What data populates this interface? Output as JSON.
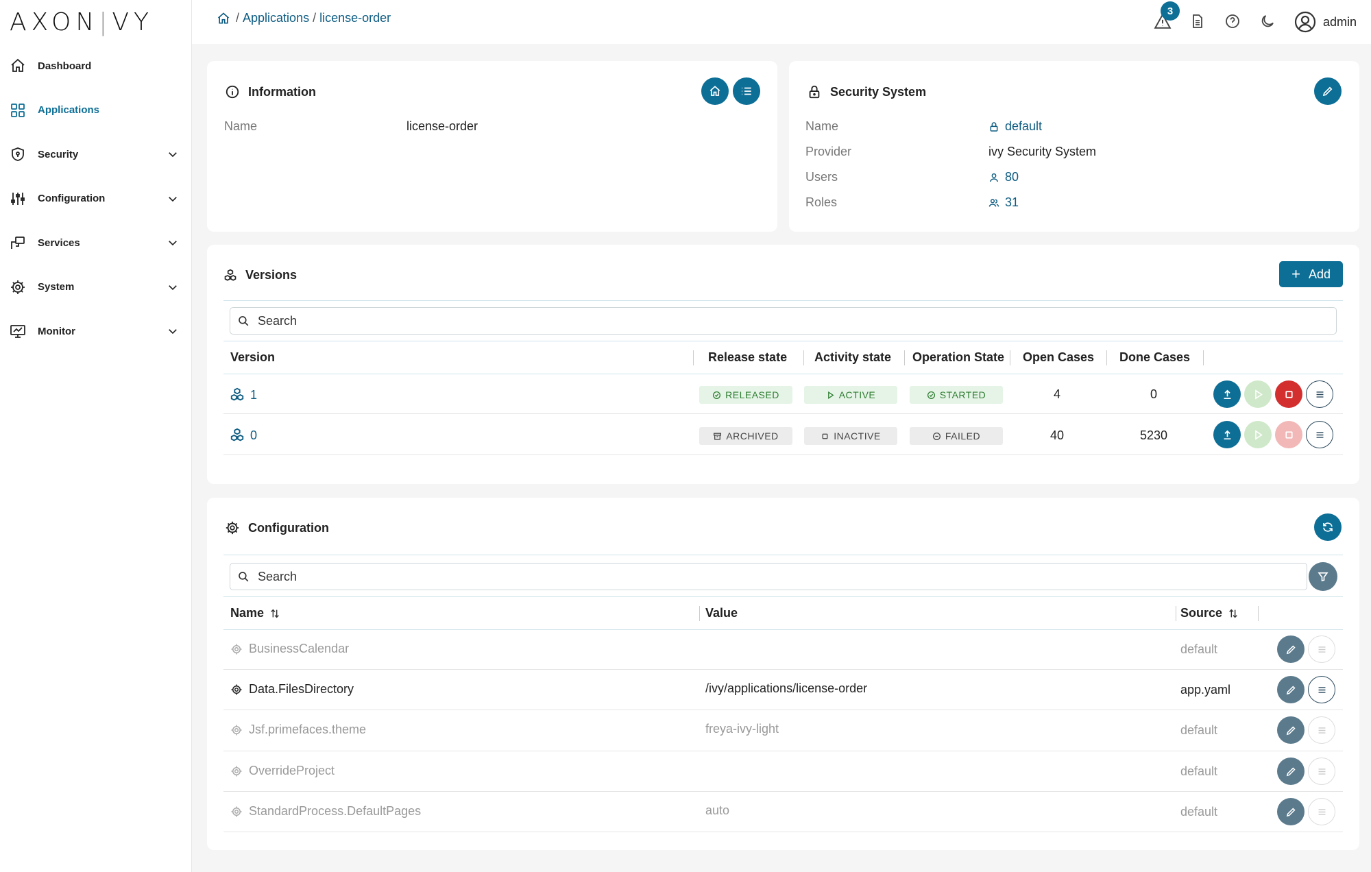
{
  "logo": {
    "left": "AXON",
    "sep": "|",
    "right": "VY"
  },
  "sidebar": {
    "items": [
      {
        "label": "Dashboard",
        "icon": "home-icon"
      },
      {
        "label": "Applications",
        "icon": "grid-icon",
        "active": true
      },
      {
        "label": "Security",
        "icon": "shield-icon"
      },
      {
        "label": "Configuration",
        "icon": "sliders-icon"
      },
      {
        "label": "Services",
        "icon": "services-icon"
      },
      {
        "label": "System",
        "icon": "gear-icon"
      },
      {
        "label": "Monitor",
        "icon": "monitor-icon"
      }
    ]
  },
  "topbar": {
    "breadcrumb": {
      "sep1": "/",
      "applications": "Applications",
      "sep2": "/",
      "current": "license-order"
    },
    "notifications_count": "3",
    "user": "admin"
  },
  "information": {
    "title": "Information",
    "name_label": "Name",
    "name_value": "license-order"
  },
  "security_system": {
    "title": "Security System",
    "rows": [
      {
        "label": "Name",
        "value": "default"
      },
      {
        "label": "Provider",
        "value": "ivy Security System"
      },
      {
        "label": "Users",
        "value": "80"
      },
      {
        "label": "Roles",
        "value": "31"
      }
    ]
  },
  "versions": {
    "title": "Versions",
    "add_label": "Add",
    "search_placeholder": "Search",
    "columns": [
      "Version",
      "Release state",
      "Activity state",
      "Operation State",
      "Open Cases",
      "Done Cases"
    ],
    "rows": [
      {
        "version": "1",
        "release": "RELEASED",
        "activity": "ACTIVE",
        "operation": "STARTED",
        "open": "4",
        "done": "0"
      },
      {
        "version": "0",
        "release": "ARCHIVED",
        "activity": "INACTIVE",
        "operation": "FAILED",
        "open": "40",
        "done": "5230"
      }
    ]
  },
  "configuration": {
    "title": "Configuration",
    "search_placeholder": "Search",
    "columns": [
      "Name",
      "Value",
      "Source"
    ],
    "rows": [
      {
        "name": "BusinessCalendar",
        "value": "",
        "source": "default"
      },
      {
        "name": "Data.FilesDirectory",
        "value": "/ivy/applications/license-order",
        "source": "app.yaml"
      },
      {
        "name": "Jsf.primefaces.theme",
        "value": "freya-ivy-light",
        "source": "default"
      },
      {
        "name": "OverrideProject",
        "value": "",
        "source": "default"
      },
      {
        "name": "StandardProcess.DefaultPages",
        "value": "auto",
        "source": "default"
      }
    ]
  },
  "colors": {
    "accent": "#0d6e96",
    "link": "#0d5c82",
    "success_bg": "#e5f4e6",
    "danger": "#d32f2f"
  }
}
